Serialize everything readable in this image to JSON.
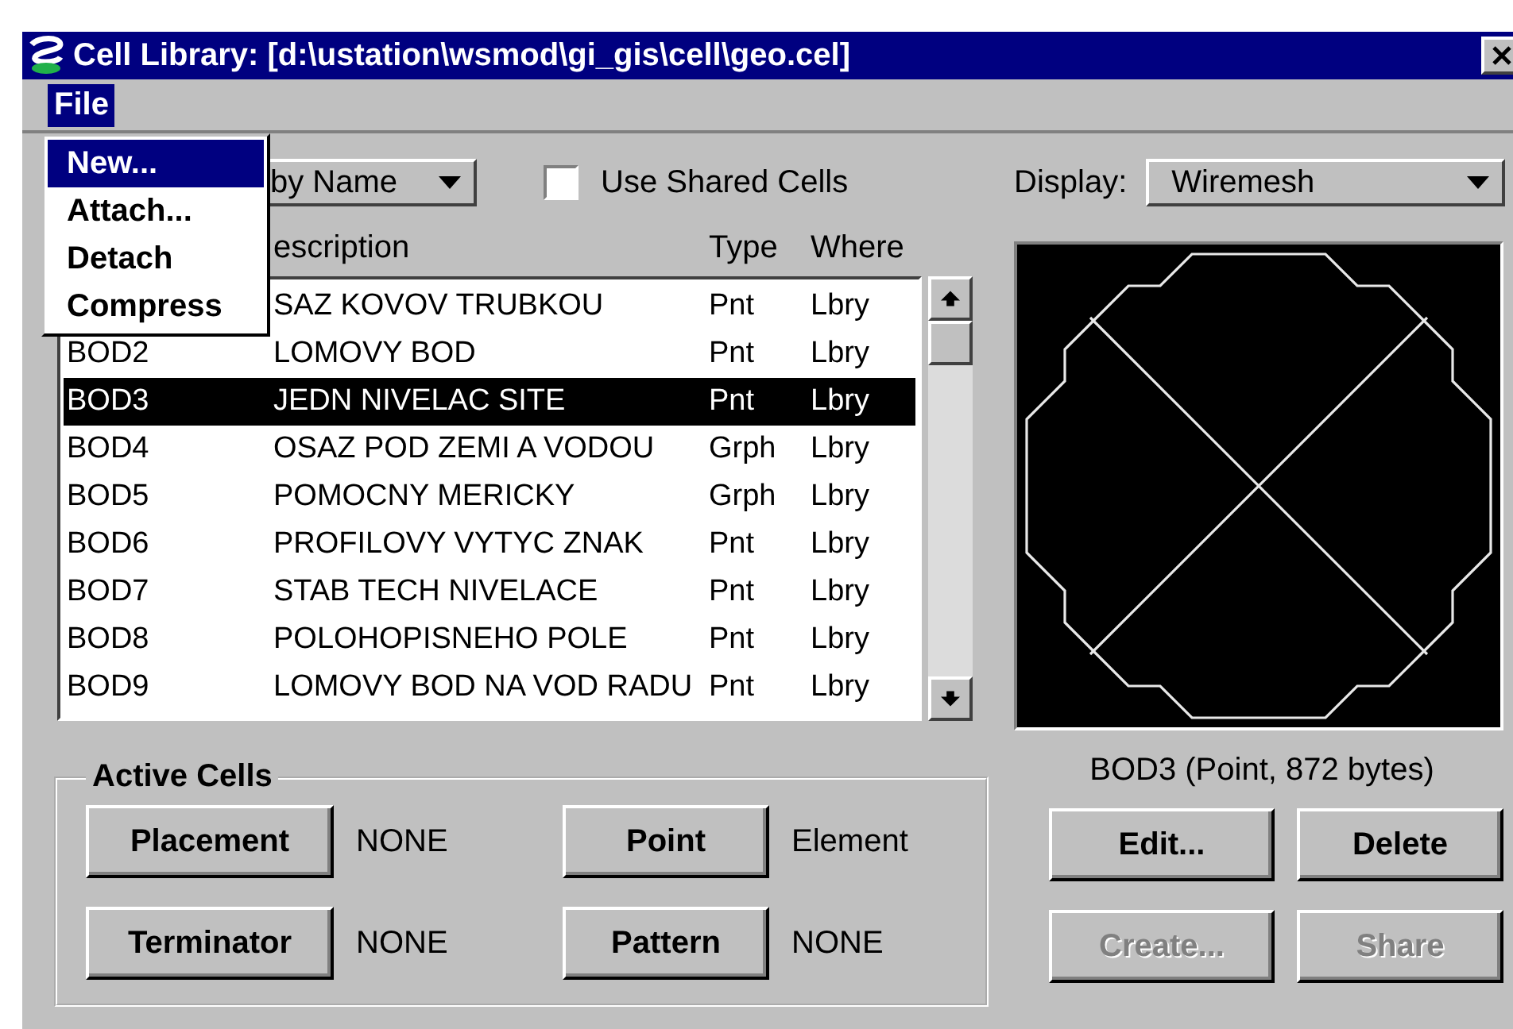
{
  "window": {
    "title": "Cell Library: [d:\\ustation\\wsmod\\gi_gis\\cell\\geo.cel]"
  },
  "menu_bar": [
    {
      "label": "File",
      "selected": true
    }
  ],
  "file_menu": [
    {
      "label": "New...",
      "selected": true
    },
    {
      "label": "Attach...",
      "selected": false
    },
    {
      "label": "Detach",
      "selected": false
    },
    {
      "label": "Compress",
      "selected": false
    }
  ],
  "sort_dropdown": {
    "value": "by Name"
  },
  "use_shared_cells": {
    "label": "Use Shared Cells",
    "checked": false
  },
  "display": {
    "label": "Display:",
    "value": "Wiremesh"
  },
  "table": {
    "columns": [
      "escription",
      "Type",
      "Where"
    ],
    "rows": [
      {
        "description": "SAZ KOVOV TRUBKOU",
        "type": "Pnt",
        "where": "Lbry",
        "selected": false
      },
      {
        "name": "BOD2",
        "description": "LOMOVY BOD",
        "type": "Pnt",
        "where": "Lbry",
        "selected": false
      },
      {
        "name": "BOD3",
        "description": "JEDN NIVELAC SITE",
        "type": "Pnt",
        "where": "Lbry",
        "selected": true
      },
      {
        "name": "BOD4",
        "description": "OSAZ POD ZEMI A VODOU",
        "type": "Grph",
        "where": "Lbry",
        "selected": false
      },
      {
        "name": "BOD5",
        "description": "POMOCNY MERICKY",
        "type": "Grph",
        "where": "Lbry",
        "selected": false
      },
      {
        "name": "BOD6",
        "description": "PROFILOVY VYTYC ZNAK",
        "type": "Pnt",
        "where": "Lbry",
        "selected": false
      },
      {
        "name": "BOD7",
        "description": "STAB TECH NIVELACE",
        "type": "Pnt",
        "where": "Lbry",
        "selected": false
      },
      {
        "name": "BOD8",
        "description": "POLOHOPISNEHO POLE",
        "type": "Pnt",
        "where": "Lbry",
        "selected": false
      },
      {
        "name": "BOD9",
        "description": "LOMOVY BOD NA VOD RADU",
        "type": "Pnt",
        "where": "Lbry",
        "selected": false
      }
    ]
  },
  "preview": {
    "caption": "BOD3 (Point, 872 bytes)"
  },
  "active_cells": {
    "title": "Active Cells",
    "items": [
      {
        "button": "Placement",
        "value": "NONE"
      },
      {
        "button": "Point",
        "value": "Element"
      },
      {
        "button": "Terminator",
        "value": "NONE"
      },
      {
        "button": "Pattern",
        "value": "NONE"
      }
    ]
  },
  "actions": [
    {
      "label": "Edit...",
      "disabled": false
    },
    {
      "label": "Delete",
      "disabled": false
    },
    {
      "label": "Create...",
      "disabled": true
    },
    {
      "label": "Share",
      "disabled": true
    }
  ]
}
